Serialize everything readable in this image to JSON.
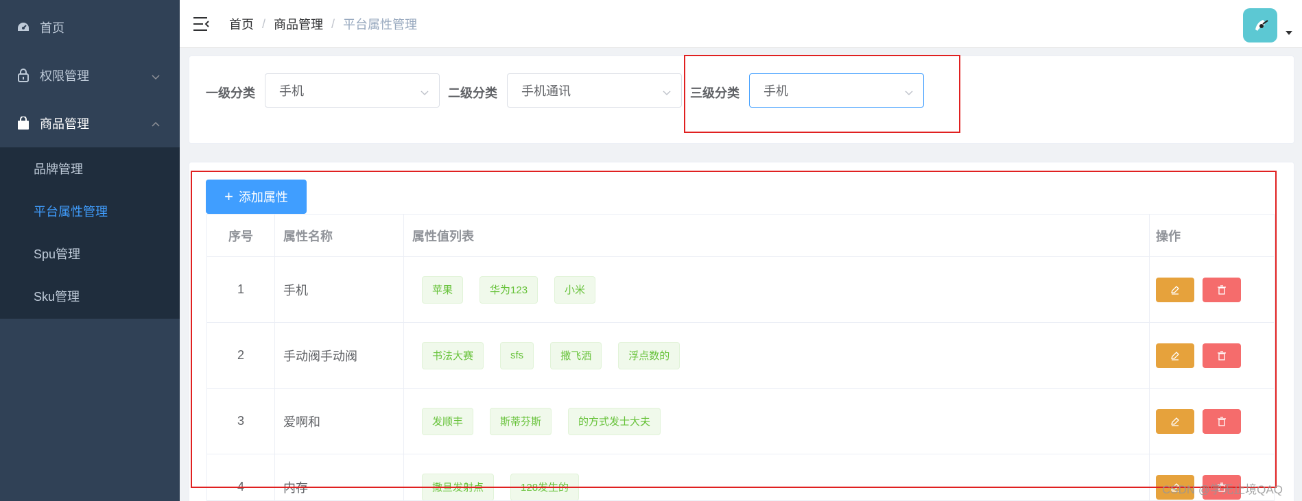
{
  "sidebar": {
    "items": [
      {
        "label": "首页",
        "icon": "dashboard-icon"
      },
      {
        "label": "权限管理",
        "icon": "lock-icon",
        "expanded": false
      },
      {
        "label": "商品管理",
        "icon": "shopping-bag-icon",
        "expanded": true
      }
    ],
    "submenu": [
      {
        "label": "品牌管理",
        "active": false
      },
      {
        "label": "平台属性管理",
        "active": true
      },
      {
        "label": "Spu管理",
        "active": false
      },
      {
        "label": "Sku管理",
        "active": false
      }
    ]
  },
  "navbar": {
    "breadcrumb": [
      "首页",
      "商品管理",
      "平台属性管理"
    ],
    "separator": "/"
  },
  "filters": [
    {
      "label": "一级分类",
      "value": "手机"
    },
    {
      "label": "二级分类",
      "value": "手机通讯"
    },
    {
      "label": "三级分类",
      "value": "手机"
    }
  ],
  "toolbar": {
    "add_label": "添加属性"
  },
  "table": {
    "headers": [
      "序号",
      "属性名称",
      "属性值列表",
      "操作"
    ],
    "rows": [
      {
        "index": "1",
        "name": "手机",
        "values": [
          "苹果",
          "华为123",
          "小米"
        ]
      },
      {
        "index": "2",
        "name": "手动阀手动阀",
        "values": [
          "书法大赛",
          "sfs",
          "撒飞洒",
          "浮点数的"
        ]
      },
      {
        "index": "3",
        "name": "爱啊和",
        "values": [
          "发顺丰",
          "斯蒂芬斯",
          "的方式发士大夫"
        ]
      },
      {
        "index": "4",
        "name": "内存",
        "values": [
          "撒旦发射点",
          "128发生的"
        ]
      }
    ]
  },
  "watermark": "CSDN @学无止境QAQ",
  "colors": {
    "sidebar_bg": "#304156",
    "submenu_bg": "#1f2d3d",
    "primary": "#409eff",
    "warning": "#e6a23c",
    "danger": "#f56c6c",
    "success": "#67c23a",
    "annotation": "#e02020"
  }
}
